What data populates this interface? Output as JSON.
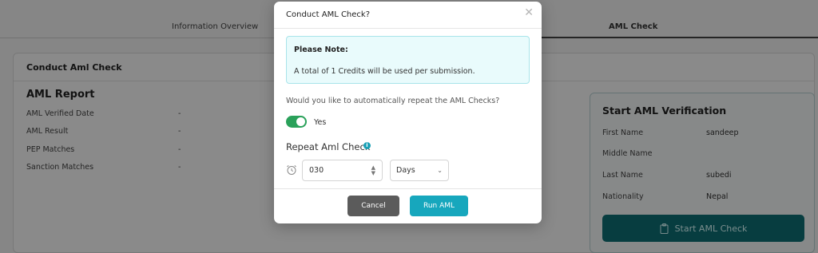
{
  "tabs": [
    {
      "label": "Information Overview"
    },
    {
      "label": "AML Check",
      "active": true
    }
  ],
  "card": {
    "title": "Conduct Aml Check"
  },
  "report": {
    "title": "AML Report",
    "rows": [
      {
        "label": "AML Verified Date",
        "value": "-"
      },
      {
        "label": "AML Result",
        "value": "-"
      },
      {
        "label": "PEP Matches",
        "value": "-"
      },
      {
        "label": "Sanction Matches",
        "value": "-"
      }
    ]
  },
  "verification": {
    "title": "Start AML Verification",
    "rows": [
      {
        "label": "First Name",
        "value": "sandeep"
      },
      {
        "label": "Middle Name",
        "value": ""
      },
      {
        "label": "Last Name",
        "value": "subedi"
      },
      {
        "label": "Nationality",
        "value": "Nepal"
      }
    ],
    "button_label": "Start AML Check",
    "button_icon": "clipboard-icon"
  },
  "modal": {
    "title": "Conduct AML Check?",
    "close_icon": "close-icon",
    "note": {
      "title": "Please Note:",
      "text": "A total of 1 Credits will be used per submission."
    },
    "question": "Would you like to automatically repeat the AML Checks?",
    "toggle": {
      "label": "Yes",
      "on": true
    },
    "repeat": {
      "title": "Repeat Aml Check",
      "value": "030",
      "unit": "Days"
    },
    "cancel_label": "Cancel",
    "run_label": "Run AML"
  },
  "colors": {
    "accent": "#17a7bd",
    "toggle_on": "#2aa15a",
    "primary_dark": "#0e6f76",
    "cancel": "#5b5b5b"
  }
}
